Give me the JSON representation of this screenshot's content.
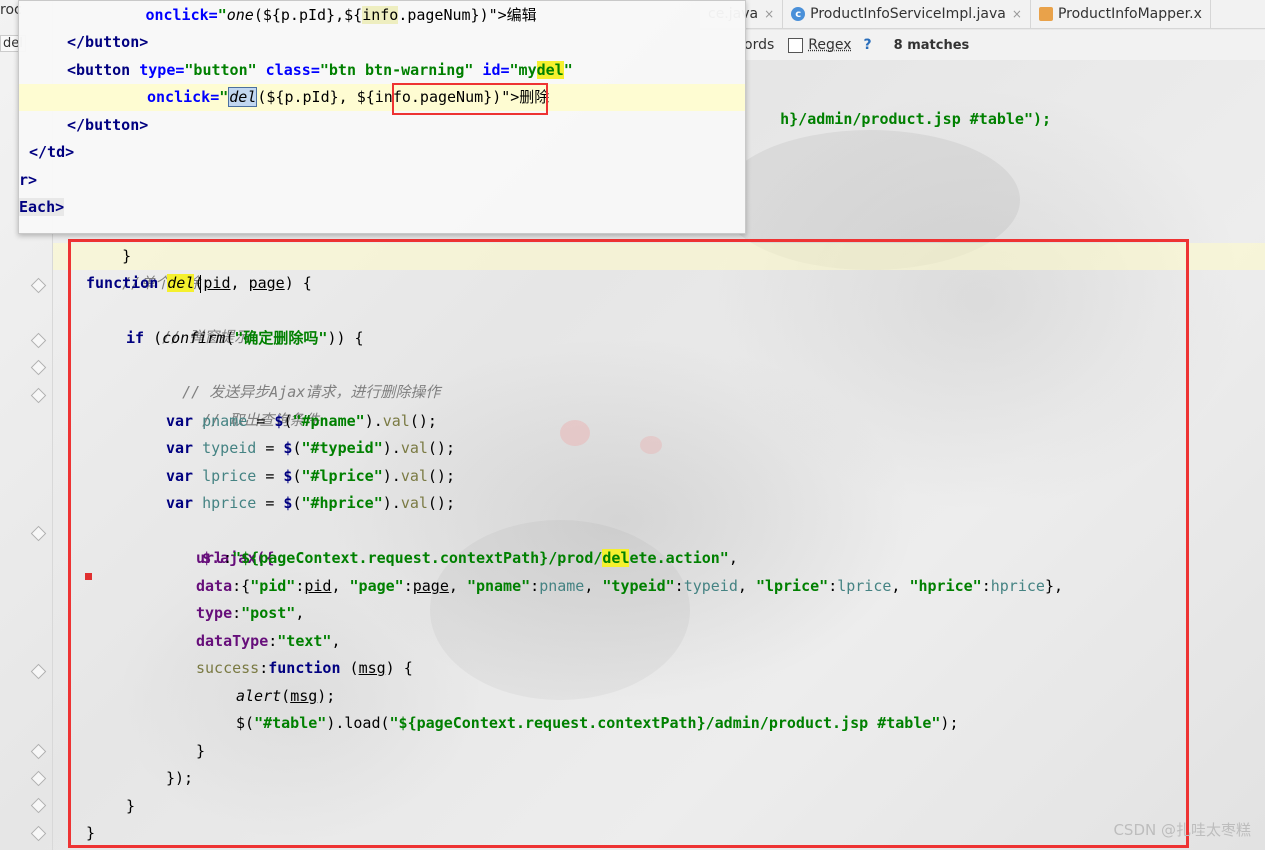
{
  "tabs": [
    {
      "label": "ce.java",
      "close": "×"
    },
    {
      "label": "ProductInfoServiceImpl.java",
      "close": "×"
    },
    {
      "label": "ProductInfoMapper.x"
    }
  ],
  "left_fragments": {
    "tab": "roc",
    "field": "del"
  },
  "findbar": {
    "words_label": "ords",
    "regex_label": "Regex",
    "help": "?",
    "matches": "8 matches"
  },
  "watermark": "CSDN @扎哇太枣糕",
  "popup": {
    "line1": {
      "indent": "              ",
      "attr": "onclick=",
      "q": "\"",
      "fn": "one",
      "rest": "(${p.pId},${",
      "info": "info",
      "rest2": ".pageNum})\">编辑"
    },
    "line2": "</button>",
    "line3": {
      "tag": "<button ",
      "a1": "type=",
      "v1": "\"button\"",
      "a2": " class=",
      "v2": "\"btn btn-warning\"",
      "a3": " id=",
      "v3a": "\"my",
      "v3b": "del",
      "v3c": "\""
    },
    "line4": {
      "attr": "onclick=",
      "q": "\"",
      "del": "del",
      "rest": "(${p.pId}, ",
      "boxed": "${info.pageNum}",
      "tail": ")\">删除"
    },
    "line5": "</button>",
    "line6": "</td>",
    "line7": "r>",
    "line8": "Each>"
  },
  "behind_line": {
    "text": "h}/admin/product.jsp #table\");"
  },
  "code": {
    "brace_top": "}",
    "comment1": "//单个删除",
    "func_kw": "function",
    "func_name": "del",
    "func_params_a": "(",
    "pid": "pid",
    "comma": ", ",
    "page": "page",
    "func_params_b": ") {",
    "comment2": "// 弹窗提示",
    "if_kw": "if",
    "confirm_fn": "confirm",
    "confirm_str": "\"确定删除吗\"",
    "if_tail": ")) {",
    "comment3": "// 发送异步Ajax请求，进行删除操作",
    "comment4": "// 取出查询条件",
    "vars": [
      {
        "kw": "var",
        "name": "pname",
        "sel": "\"#pname\""
      },
      {
        "kw": "var",
        "name": "typeid",
        "sel": "\"#typeid\""
      },
      {
        "kw": "var",
        "name": "lprice",
        "sel": "\"#lprice\""
      },
      {
        "kw": "var",
        "name": "hprice",
        "sel": "\"#hprice\""
      }
    ],
    "ajax_open": "$.ajax({",
    "url_key": "url",
    "url_val_a": "\"${pageContext.request.contextPath}/prod/",
    "url_val_hl": "del",
    "url_val_b": "ete.action\"",
    "data_key": "data",
    "data_val": [
      {
        "k": "\"pid\"",
        "v": "pid",
        "und": true
      },
      {
        "k": "\"page\"",
        "v": "page",
        "und": true
      },
      {
        "k": "\"pname\"",
        "v": "pname",
        "und": false
      },
      {
        "k": "\"typeid\"",
        "v": "typeid",
        "und": false
      },
      {
        "k": "\"lprice\"",
        "v": "lprice",
        "und": false
      },
      {
        "k": "\"hprice\"",
        "v": "hprice",
        "und": false
      }
    ],
    "type_key": "type",
    "type_val": "\"post\"",
    "datatype_key": "dataType",
    "datatype_val": "\"text\"",
    "success_key": "success",
    "success_fn": "function",
    "msg": "msg",
    "alert_fn": "alert",
    "load_sel": "\"#table\"",
    "load_fn": "load",
    "load_url": "\"${pageContext.request.contextPath}/admin/product.jsp #table\"",
    "close1": "}",
    "close2": "});",
    "close3": "}",
    "close4": "}"
  }
}
